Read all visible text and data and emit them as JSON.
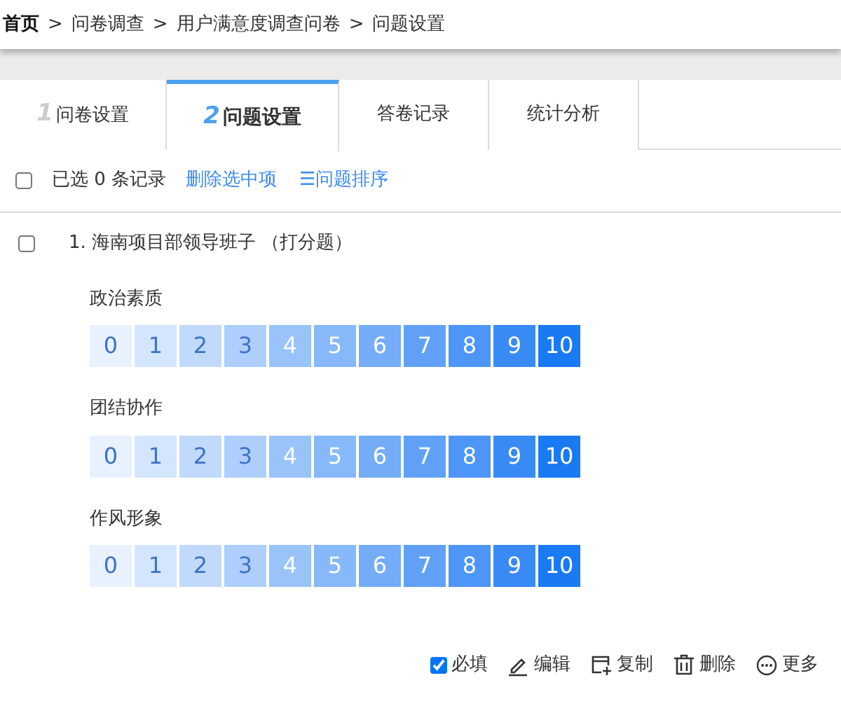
{
  "breadcrumb": [
    {
      "label": "首页",
      "bold": true
    },
    {
      "label": "问卷调查",
      "bold": false
    },
    {
      "label": "用户满意度调查问卷",
      "bold": false
    },
    {
      "label": "问题设置",
      "bold": false
    }
  ],
  "breadcrumb_separator": ">",
  "tabs": [
    {
      "number": "1",
      "label": "问卷设置",
      "selected": false
    },
    {
      "number": "2",
      "label": "问题设置",
      "selected": true
    },
    {
      "label": "答卷记录",
      "selected": false
    },
    {
      "label": "统计分析",
      "selected": false
    }
  ],
  "toolbar": {
    "select_all_checked": false,
    "selection_count": "已选 0 条记录",
    "delete_selected": "删除选中项",
    "sort_icon": "☰",
    "sort": "问题排序"
  },
  "question": {
    "checked": false,
    "title": "1. 海南项目部领导班子 （打分题）",
    "items": [
      {
        "label": "政治素质",
        "scale": [
          {
            "value": "0",
            "color": "#e8f1fe"
          },
          {
            "value": "1",
            "color": "#d4e6fd"
          },
          {
            "value": "2",
            "color": "#c1dafc"
          },
          {
            "value": "3",
            "color": "#aecffb"
          },
          {
            "value": "4",
            "color": "#9ac3fa"
          },
          {
            "value": "5",
            "color": "#87b8f9"
          },
          {
            "value": "6",
            "color": "#74acf8"
          },
          {
            "value": "7",
            "color": "#60a1f7"
          },
          {
            "value": "8",
            "color": "#4d95f6"
          },
          {
            "value": "9",
            "color": "#3a8af5"
          },
          {
            "value": "10",
            "color": "#1a7af3"
          }
        ]
      },
      {
        "label": "团结协作",
        "scale": [
          {
            "value": "0",
            "color": "#e8f1fe"
          },
          {
            "value": "1",
            "color": "#d4e6fd"
          },
          {
            "value": "2",
            "color": "#c1dafc"
          },
          {
            "value": "3",
            "color": "#aecffb"
          },
          {
            "value": "4",
            "color": "#9ac3fa"
          },
          {
            "value": "5",
            "color": "#87b8f9"
          },
          {
            "value": "6",
            "color": "#74acf8"
          },
          {
            "value": "7",
            "color": "#60a1f7"
          },
          {
            "value": "8",
            "color": "#4d95f6"
          },
          {
            "value": "9",
            "color": "#3a8af5"
          },
          {
            "value": "10",
            "color": "#1a7af3"
          }
        ]
      },
      {
        "label": "作风形象",
        "scale": [
          {
            "value": "0",
            "color": "#e8f1fe"
          },
          {
            "value": "1",
            "color": "#d4e6fd"
          },
          {
            "value": "2",
            "color": "#c1dafc"
          },
          {
            "value": "3",
            "color": "#aecffb"
          },
          {
            "value": "4",
            "color": "#9ac3fa"
          },
          {
            "value": "5",
            "color": "#87b8f9"
          },
          {
            "value": "6",
            "color": "#74acf8"
          },
          {
            "value": "7",
            "color": "#60a1f7"
          },
          {
            "value": "8",
            "color": "#4d95f6"
          },
          {
            "value": "9",
            "color": "#3a8af5"
          },
          {
            "value": "10",
            "color": "#1a7af3"
          }
        ]
      }
    ],
    "required": {
      "label": "必填",
      "checked": true
    },
    "actions": [
      {
        "kind": "edit",
        "label": "编辑"
      },
      {
        "kind": "copy",
        "label": "复制"
      },
      {
        "kind": "delete",
        "label": "删除"
      },
      {
        "kind": "more",
        "label": "更多"
      }
    ]
  }
}
